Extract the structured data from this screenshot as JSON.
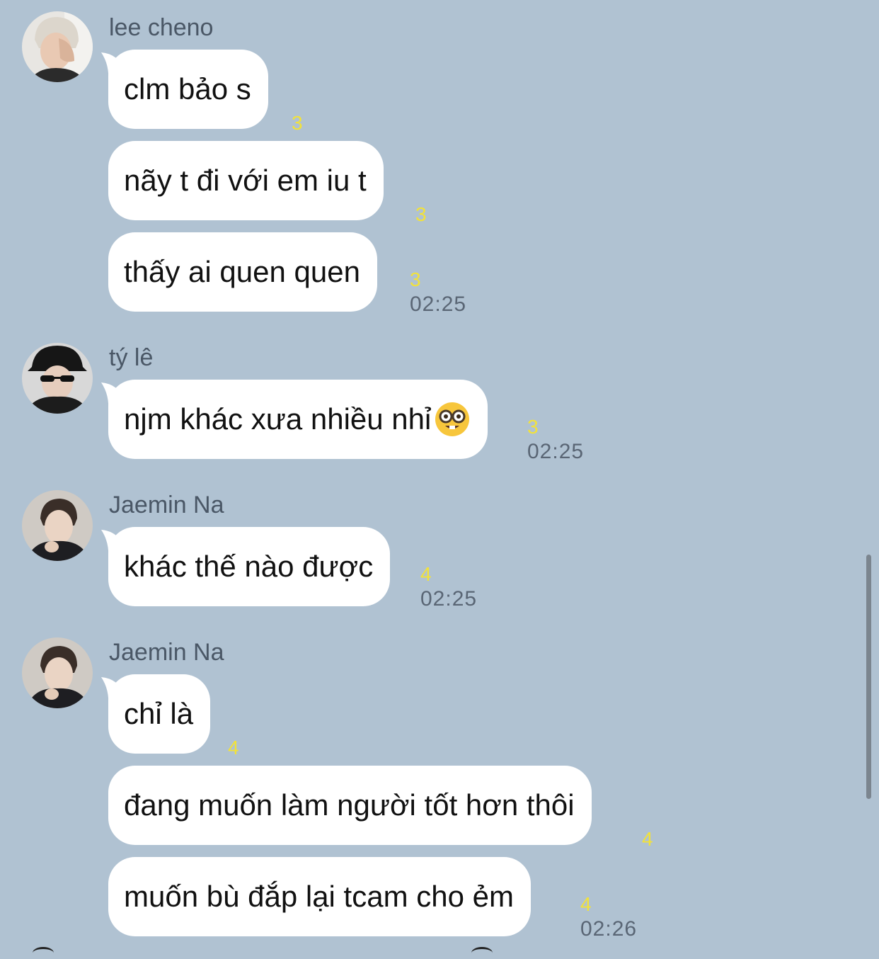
{
  "groups": [
    {
      "sender": "lee cheno",
      "avatar_icon": "avatar-photo-lee-cheno",
      "messages": [
        {
          "text": "clm bảo s",
          "read_count": "3",
          "time": ""
        },
        {
          "text": "nãy t đi với em iu t",
          "read_count": "3",
          "time": ""
        },
        {
          "text": "thấy ai quen quen",
          "read_count": "3",
          "time": "02:25"
        }
      ]
    },
    {
      "sender": "tý lê",
      "avatar_icon": "avatar-photo-ty-le",
      "messages": [
        {
          "text": "njm khác xưa nhiều nhỉ",
          "emoji": "nerd-face-emoji",
          "read_count": "3",
          "time": "02:25"
        }
      ]
    },
    {
      "sender": "Jaemin Na",
      "avatar_icon": "avatar-photo-jaemin-na",
      "messages": [
        {
          "text": "khác thế nào được",
          "read_count": "4",
          "time": "02:25"
        }
      ]
    },
    {
      "sender": "Jaemin Na",
      "avatar_icon": "avatar-photo-jaemin-na",
      "messages": [
        {
          "text": "chỉ là",
          "read_count": "4",
          "time": ""
        },
        {
          "text": "đang muốn làm người tốt hơn thôi",
          "read_count": "4",
          "time": ""
        },
        {
          "text": "muốn bù đắp lại tcam cho ẻm",
          "read_count": "4",
          "time": "02:26"
        }
      ]
    }
  ],
  "colors": {
    "background": "#b0c2d2",
    "bubble": "#ffffff",
    "read_count": "#f2e23a",
    "timestamp": "#5a6675",
    "sender": "#4a5766"
  }
}
